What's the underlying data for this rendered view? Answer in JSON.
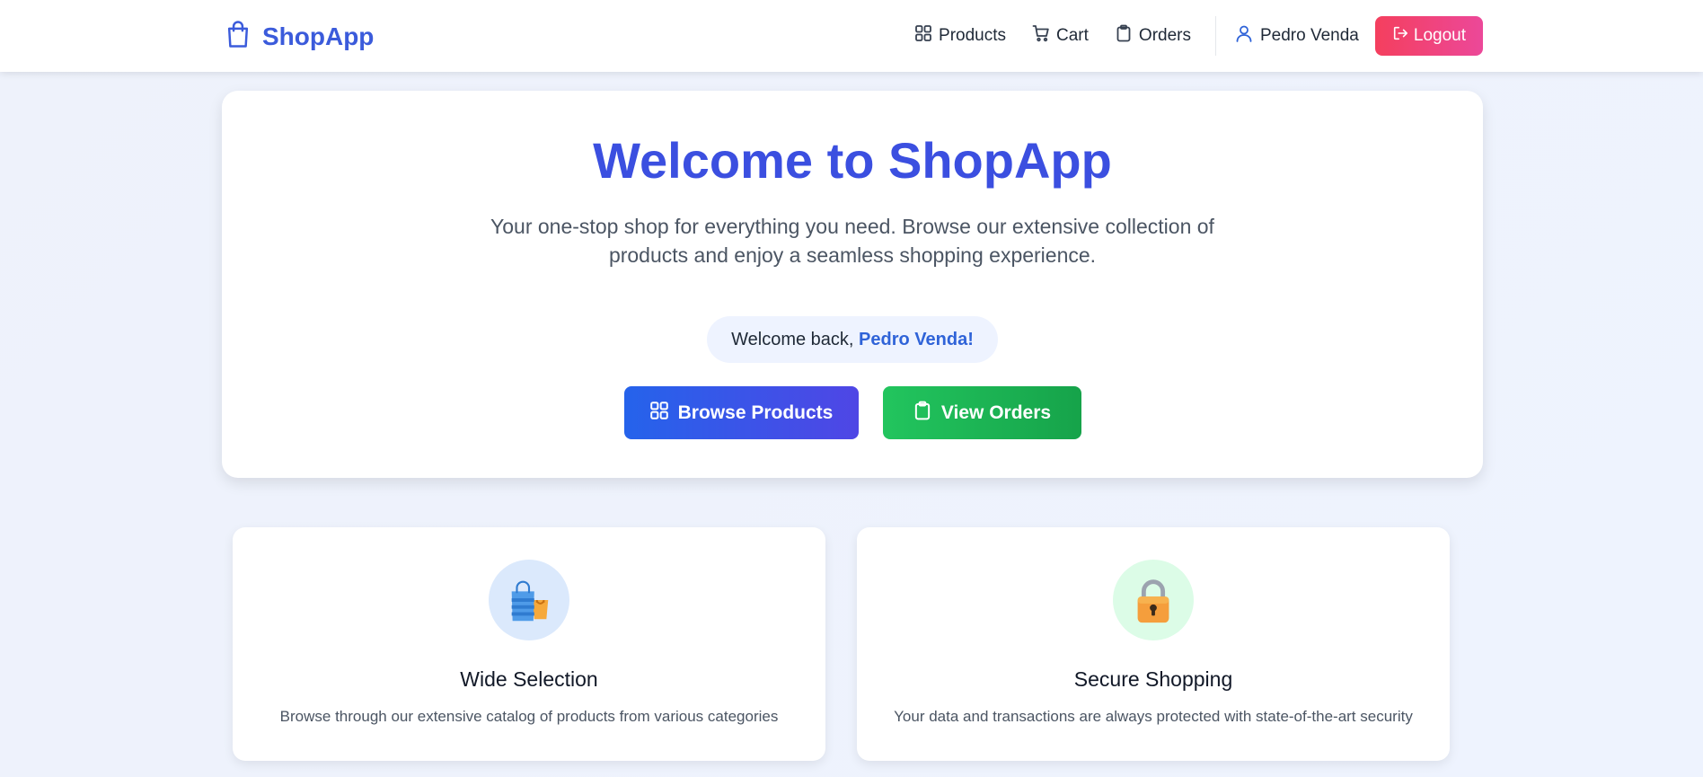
{
  "header": {
    "brand": "ShopApp",
    "nav": {
      "products": "Products",
      "cart": "Cart",
      "orders": "Orders"
    },
    "user": "Pedro Venda",
    "logout": "Logout"
  },
  "hero": {
    "title": "Welcome to ShopApp",
    "subtitle": "Your one-stop shop for everything you need. Browse our extensive collection of products and enjoy a seamless shopping experience.",
    "welcome_prefix": "Welcome back, ",
    "welcome_name": "Pedro Venda!",
    "browse_label": "Browse Products",
    "orders_label": "View Orders"
  },
  "features": [
    {
      "icon": "shopping-bags-icon",
      "title": "Wide Selection",
      "description": "Browse through our extensive catalog of products from various categories"
    },
    {
      "icon": "padlock-icon",
      "title": "Secure Shopping",
      "description": "Your data and transactions are always protected with state-of-the-art security"
    }
  ],
  "colors": {
    "brand": "#3b5bdb",
    "primary": "#2563eb",
    "success": "#22c55e",
    "danger": "#f43f5e"
  }
}
